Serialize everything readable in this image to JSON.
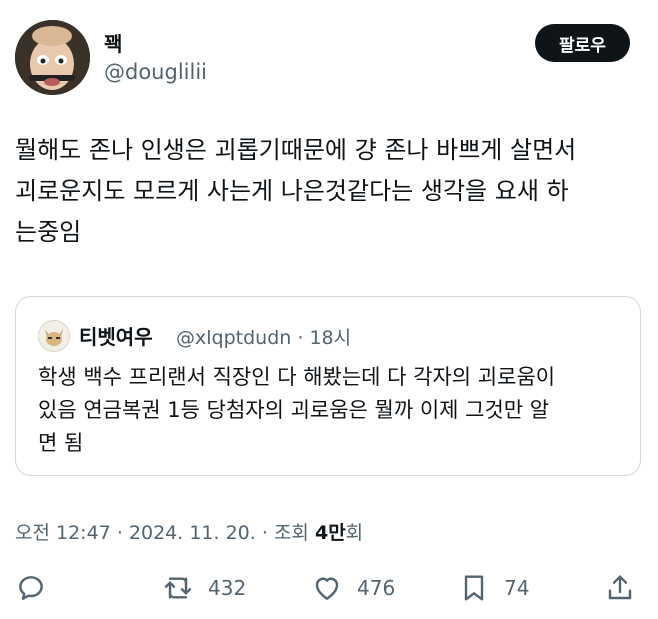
{
  "author": {
    "display_name": "꽥",
    "handle": "@douglilii"
  },
  "follow_button": {
    "label": "팔로우"
  },
  "tweet": {
    "text": "뭘해도 존나 인생은 괴롭기때문에 걍 존나 바쁘게 살면서\n괴로운지도 모르게 사는게 나은것같다는 생각을 요새 하\n는중임"
  },
  "quote": {
    "display_name": "티벳여우",
    "handle": "@xlqptdudn",
    "separator": "·",
    "time": "18시",
    "text": "학생 백수 프리랜서 직장인 다 해봤는데 다 각자의 괴로움이\n있음 연금복권 1등 당첨자의 괴로움은 뭘까 이제 그것만 알\n면 됨"
  },
  "meta": {
    "time": "오전 12:47",
    "sep1": "·",
    "date": "2024. 11. 20.",
    "sep2": "·",
    "views_label": "조회",
    "views_count": "4만",
    "views_suffix": "회"
  },
  "actions": {
    "reply": {
      "icon": "reply-icon"
    },
    "retweet": {
      "icon": "retweet-icon",
      "count": "432"
    },
    "like": {
      "icon": "heart-icon",
      "count": "476"
    },
    "bookmark": {
      "icon": "bookmark-icon",
      "count": "74"
    },
    "share": {
      "icon": "share-icon"
    }
  },
  "colors": {
    "text_primary": "#0f1419",
    "text_secondary": "#536471",
    "border": "#cfd9de",
    "button_bg": "#0f1419"
  }
}
